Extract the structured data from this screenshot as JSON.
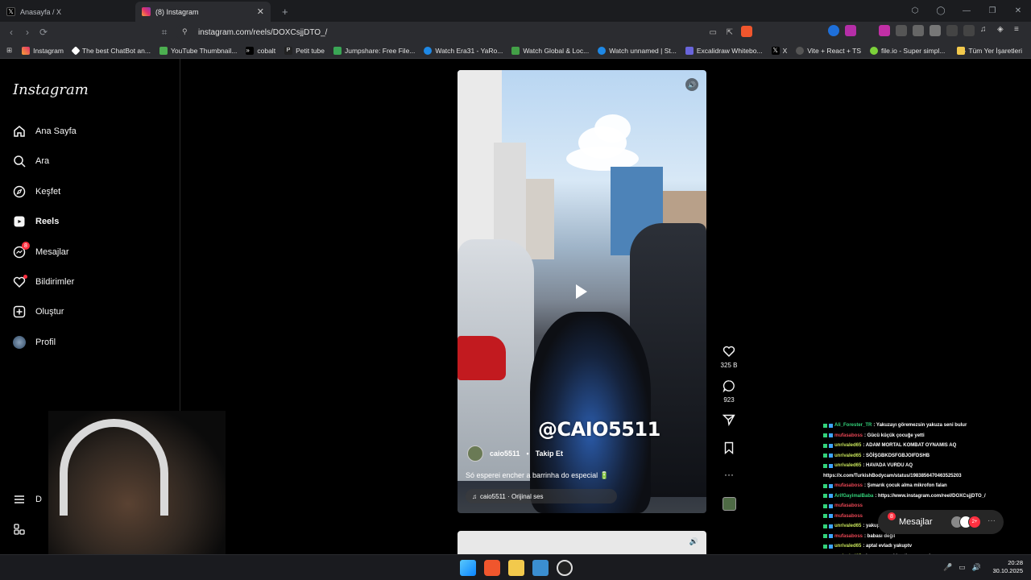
{
  "browser": {
    "tabs": [
      {
        "label": "Anasayfa / X",
        "active": false
      },
      {
        "label": "(8) Instagram",
        "active": true
      }
    ],
    "url": "instagram.com/reels/DOXCsjjDTO_/",
    "bookmarks": [
      "Instagram",
      "The best ChatBot an...",
      "YouTube Thumbnail...",
      "cobalt",
      "Petit tube",
      "Jumpshare: Free File...",
      "Watch Era31 - YaRo...",
      "Watch Global & Loc...",
      "Watch unnamed | St...",
      "Excalidraw Whitebo...",
      "X",
      "Vite + React + TS",
      "file.io - Super simpl..."
    ],
    "bookmarks_folder": "Tüm Yer İşaretleri"
  },
  "sidebar": {
    "logo": "Instagram",
    "items": [
      {
        "label": "Ana Sayfa",
        "icon": "home-icon"
      },
      {
        "label": "Ara",
        "icon": "search-icon"
      },
      {
        "label": "Keşfet",
        "icon": "compass-icon"
      },
      {
        "label": "Reels",
        "icon": "reels-icon"
      },
      {
        "label": "Mesajlar",
        "icon": "messenger-icon",
        "badge": "8"
      },
      {
        "label": "Bildirimler",
        "icon": "heart-icon"
      },
      {
        "label": "Oluştur",
        "icon": "plus-square-icon"
      },
      {
        "label": "Profil",
        "icon": "avatar-icon"
      }
    ],
    "more_label": "D"
  },
  "reel": {
    "watermark": "@CAIO5511",
    "author": "caio5511",
    "follow_label": "Takip Et",
    "caption": "Só esperei encher a barrinha do especial 🔋",
    "audio": "caio5511 · Orijinal ses",
    "likes": "325 B",
    "comments": "923"
  },
  "chat": {
    "lines": [
      {
        "user": "Ali_Forester_TR",
        "color": "#33d17a",
        "text": ": Yakuzayı göremezsin yakuza seni bulur"
      },
      {
        "user": "mufasaboss",
        "color": "#e64553",
        "text": ": Gücü küçük çocuğe yetti"
      },
      {
        "user": "unrivaled65",
        "color": "#c6e35a",
        "text": ": ADAM MORTAL KOMBAT OYNAMIS AQ"
      },
      {
        "user": "unrivaled65",
        "color": "#c6e35a",
        "text": ": SÖİŞGBKDSFGBJOIFDSHB"
      },
      {
        "user": "unrivaled65",
        "color": "#c6e35a",
        "text": ": HAVADA VURDU AQ"
      },
      {
        "user": "",
        "color": "#ffffff",
        "text": "https://x.com/TurkishBodycam/status/1983856470463525203"
      },
      {
        "user": "mufasaboss",
        "color": "#e64553",
        "text": ": Şımarık çocuk alma mikrofon falan"
      },
      {
        "user": "ArifGayimalBaba",
        "color": "#33d17a",
        "text": ": https://www.instagram.com/reel/DOXCsjjDTO_/"
      },
      {
        "user": "mufasaboss",
        "color": "#e64553",
        "text": ""
      },
      {
        "user": "mufasaboss",
        "color": "#e64553",
        "text": ""
      },
      {
        "user": "unrivaled65",
        "color": "#c6e35a",
        "text": ": yakuptv nin anasını skm"
      },
      {
        "user": "mufasaboss",
        "color": "#e64553",
        "text": ": babası değil"
      },
      {
        "user": "unrivaled65",
        "color": "#c6e35a",
        "text": ": aptal evladı yakuptv"
      },
      {
        "user": "unrivaled65",
        "color": "#c6e35a",
        "text": ": kasını seçmi kesti anasını skm"
      },
      {
        "user": "Ali_Forester_TR",
        "color": "#33d17a",
        "text": ": 😩"
      }
    ]
  },
  "messages_pill": {
    "label": "Mesajlar",
    "badge": "8",
    "extra": "2+"
  },
  "taskbar": {
    "time": "20:28",
    "date": "30.10.2025"
  },
  "colors": {
    "accent_red": "#ff3040",
    "background": "#000000",
    "chrome": "#2b2c30"
  }
}
